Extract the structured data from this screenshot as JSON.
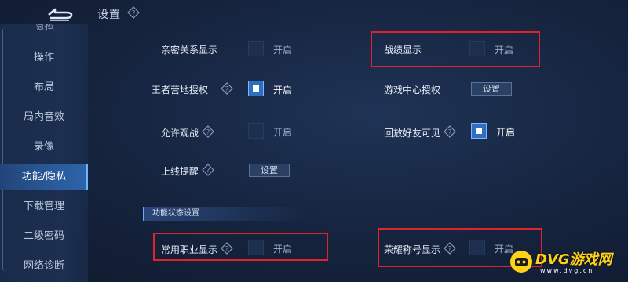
{
  "header": {
    "title": "设置"
  },
  "sidebar": {
    "cut_item": "隐私",
    "items": [
      {
        "label": "操作",
        "active": false
      },
      {
        "label": "布局",
        "active": false
      },
      {
        "label": "局内音效",
        "active": false
      },
      {
        "label": "录像",
        "active": false
      },
      {
        "label": "功能/隐私",
        "active": true
      },
      {
        "label": "下载管理",
        "active": false
      },
      {
        "label": "二级密码",
        "active": false
      },
      {
        "label": "网络诊断",
        "active": false
      }
    ]
  },
  "settings": {
    "intimacy": {
      "label": "亲密关系显示",
      "toggle_text": "开启",
      "on": false
    },
    "record": {
      "label": "战绩显示",
      "toggle_text": "开启",
      "on": false
    },
    "camp_auth": {
      "label": "王者营地授权",
      "toggle_text": "开启",
      "on": true
    },
    "game_center_auth": {
      "label": "游戏中心授权",
      "button": "设置"
    },
    "allow_spectate": {
      "label": "允许观战",
      "toggle_text": "开启",
      "on": false
    },
    "replay_friends": {
      "label": "回放好友可见",
      "toggle_text": "开启",
      "on": true
    },
    "online_remind": {
      "label": "上线提醒",
      "button": "设置"
    }
  },
  "status_section": {
    "title": "功能状态设置",
    "common_role": {
      "label": "常用职业显示",
      "toggle_text": "开启",
      "on": false
    },
    "honor_title": {
      "label": "荣耀称号显示",
      "toggle_text": "开启",
      "on": false
    }
  },
  "watermark": {
    "text": "DVG游戏网",
    "sub": "www.dvg.cn"
  },
  "colors": {
    "highlight": "#e2222a",
    "toggle_on": "#2f6fc0",
    "watermark": "#ffd21a"
  }
}
